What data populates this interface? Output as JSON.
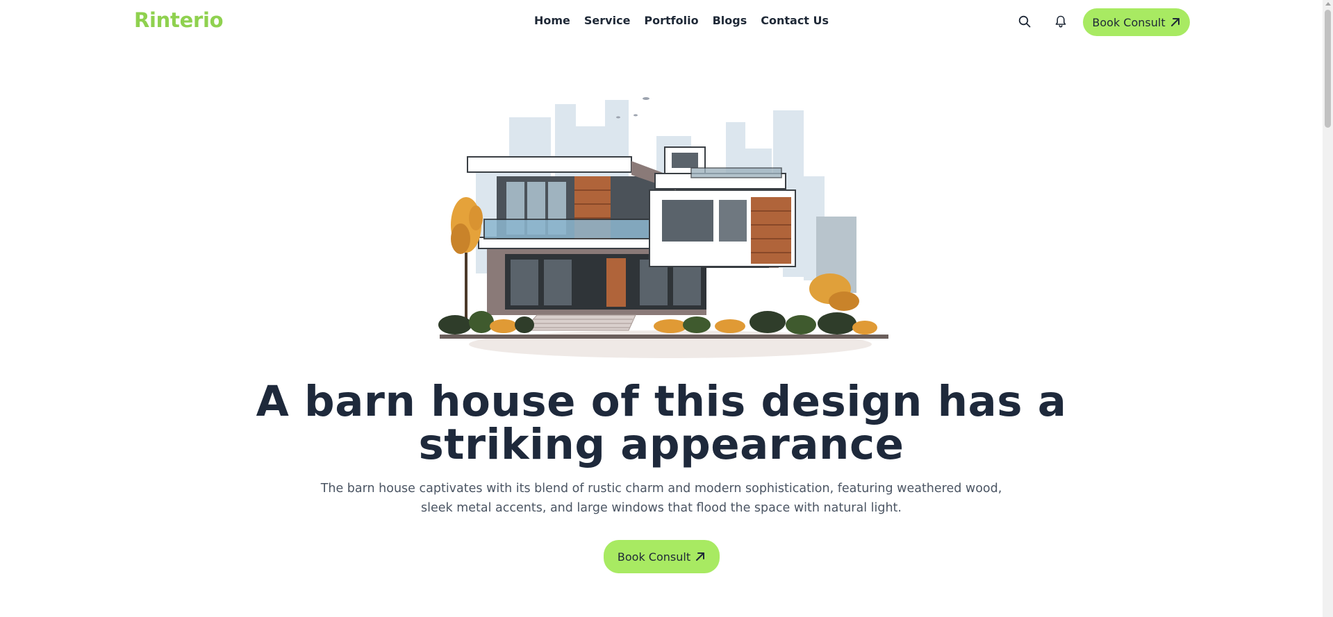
{
  "brand": {
    "logo": "Rinterio",
    "accent_color": "#a8ea62",
    "logo_color": "#8fd14f"
  },
  "nav": {
    "links": [
      "Home",
      "Service",
      "Portfolio",
      "Blogs",
      "Contact Us"
    ],
    "search_icon": "search-icon",
    "bell_icon": "bell-icon",
    "cta_label": "Book Consult",
    "cta_icon": "arrow-up-right-icon"
  },
  "hero": {
    "illustration": "modern-house-illustration",
    "headline": "A barn house of this design has a striking appearance",
    "subtitle": "The barn house captivates with its blend of rustic charm and modern sophistication, featuring weathered wood, sleek metal accents, and large windows that flood the space with natural light.",
    "cta_label": "Book Consult"
  }
}
